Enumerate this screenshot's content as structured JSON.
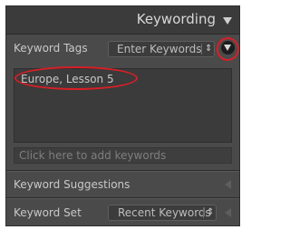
{
  "panel": {
    "title": "Keywording"
  },
  "keyword_tags": {
    "label": "Keyword Tags",
    "mode": "Enter Keywords",
    "mode_arrows": "⇕",
    "keywords_text": "Europe, Lesson 5",
    "add_placeholder": "Click here to add keywords"
  },
  "keyword_suggestions": {
    "label": "Keyword Suggestions"
  },
  "keyword_set": {
    "label": "Keyword Set",
    "value": "Recent Keywords",
    "arrows": "⇕"
  },
  "annotation_color": "#d81f26"
}
